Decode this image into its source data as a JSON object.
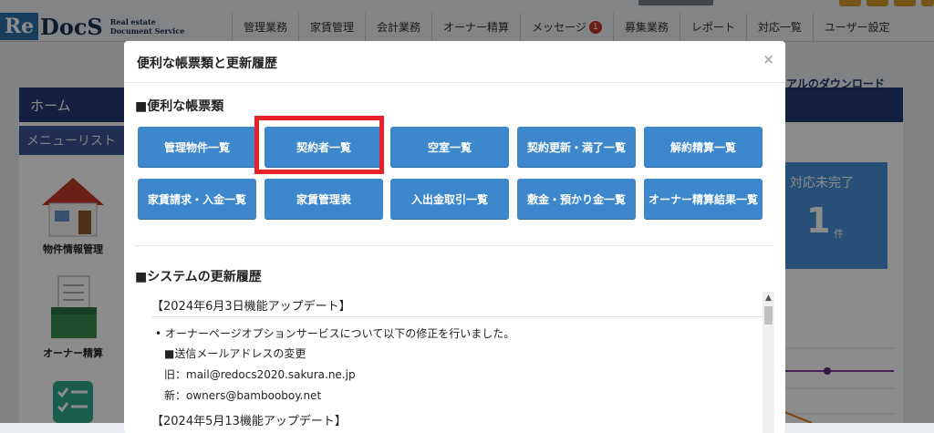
{
  "app": {
    "logo_mark": "Re",
    "logo_word": "DocS",
    "logo_sub_line1": "Real estate",
    "logo_sub_line2": "Document Service"
  },
  "nav": {
    "items": [
      "管理業務",
      "家賃管理",
      "会計業務",
      "オーナー精算",
      "メッセージ",
      "募集業務",
      "レポート",
      "対応一覧",
      "ユーザー設定"
    ],
    "message_badge": "1"
  },
  "sidebar": {
    "home": "ホーム",
    "menu_list": "メニューリスト",
    "item1": "物件情報管理",
    "item2": "オーナー精算"
  },
  "right_panel": {
    "manual_link": "アルのダウンロード",
    "tile_label": "対応未完了",
    "tile_count": "1",
    "tile_unit": "件"
  },
  "modal": {
    "title": "便利な帳票類と更新履歴",
    "close": "×",
    "forms_section": "■便利な帳票類",
    "buttons": [
      "管理物件一覧",
      "契約者一覧",
      "空室一覧",
      "契約更新・満了一覧",
      "解約精算一覧",
      "家賃請求・入金一覧",
      "家賃管理表",
      "入出金取引一覧",
      "敷金・預かり金一覧",
      "オーナー精算結果一覧"
    ],
    "history_section": "■システムの更新履歴",
    "history": {
      "entry1_date": "【2024年6月3日機能アップデート】",
      "entry1_bullet": "オーナーページオプションサービスについて以下の修正を行いました。",
      "entry1_sub": "■送信メールアドレスの変更",
      "entry1_old": "旧：mail@redocs2020.sakura.ne.jp",
      "entry1_new": "新：owners@bambooboy.net",
      "entry2_date": "【2024年5月13機能アップデート】"
    },
    "scroll_up": "▲"
  },
  "colors": {
    "button_blue": "#3d88cc",
    "highlight_red": "#e8202a",
    "header_navy": "#243b73"
  }
}
